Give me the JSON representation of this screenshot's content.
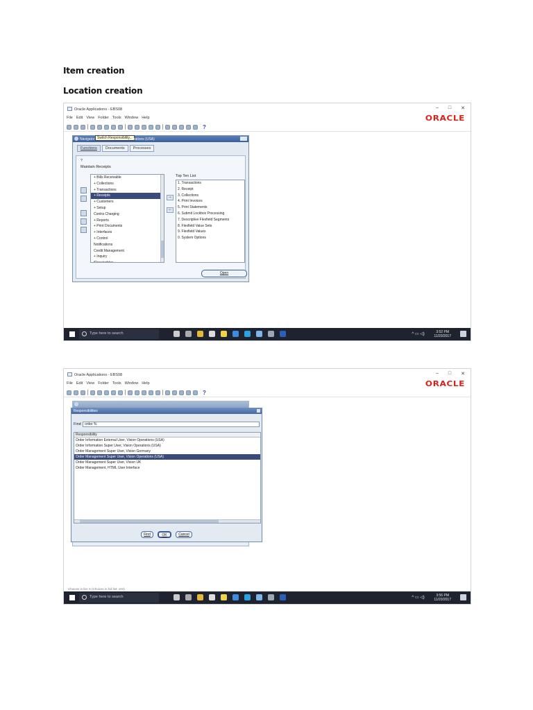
{
  "doc": {
    "heading1": "Item creation",
    "heading2": "Location creation"
  },
  "shared": {
    "app_title": "Oracle Applications - EBS08",
    "menu": [
      "File",
      "Edit",
      "View",
      "Folder",
      "Tools",
      "Window",
      "Help"
    ],
    "logo": "ORACLE",
    "win_minimize": "–",
    "win_maximize": "□",
    "win_close": "✕",
    "help_glyph": "?",
    "taskbar_search": "Type here to search"
  },
  "shot1": {
    "nav_title": "Navigator",
    "tooltip": "Switch Responsibility...",
    "nav_title_rest": "erations (USA)",
    "tabs": [
      "Functions",
      "Documents",
      "Processes"
    ],
    "question": "?",
    "section": "Maintain Receipts",
    "tree_items": [
      {
        "label": "+ Bills Receivable",
        "selected": false
      },
      {
        "label": "+ Collections",
        "selected": false
      },
      {
        "label": "+ Transactions",
        "selected": false
      },
      {
        "label": "+ Receipts",
        "selected": true
      },
      {
        "label": "+ Customers",
        "selected": false
      },
      {
        "label": "+ Setup",
        "selected": false
      },
      {
        "label": "   Contra Charging",
        "selected": false
      },
      {
        "label": "+ Reports",
        "selected": false
      },
      {
        "label": "+ Print Documents",
        "selected": false
      },
      {
        "label": "+ Interfaces",
        "selected": false
      },
      {
        "label": "+ Control",
        "selected": false
      },
      {
        "label": "   Notifications",
        "selected": false
      },
      {
        "label": "   Credit Management",
        "selected": false
      },
      {
        "label": "+ Inquiry",
        "selected": false
      },
      {
        "label": "   iReceivables",
        "selected": false
      }
    ],
    "topten_label": "Top Ten List",
    "topten_items": [
      "1. Transactions",
      "2. Receipt",
      "3. Collections",
      "4. Print Invoices",
      "5. Print Statements",
      "6. Submit Lockbox Processing",
      "7. Descriptive Flexfield Segments",
      "8. Flexfield Value Sets",
      "9. Flexfield Values",
      "0. System Options"
    ],
    "open_button": "Open",
    "clock_time": "3:52 PM",
    "clock_date": "11/20/2017"
  },
  "shot2": {
    "dialog_title": "Responsibilities",
    "find_label": "Find",
    "find_value": "order %",
    "column_header": "Responsibility",
    "items": [
      {
        "label": "Order Information External User, Vision Operations (USA)",
        "selected": false
      },
      {
        "label": "Order Information Super User, Vision Operations (USA)",
        "selected": false
      },
      {
        "label": "Order Management Super User, Vision Germany",
        "selected": false
      },
      {
        "label": "Order Management Super User, Vision Operations (USA)",
        "selected": true
      },
      {
        "label": "Order Management Super User, Vision UK",
        "selected": false
      },
      {
        "label": "Order Management, HTML User Interface",
        "selected": false
      }
    ],
    "find_button": "Find",
    "ok_button": "OK",
    "cancel_button": "Cancel",
    "status_text": "Choices in list: 6 (Choices in full list: 104)",
    "clock_time": "3:56 PM",
    "clock_date": "11/20/2017"
  },
  "colors": {
    "oracle_red": "#d6231c",
    "selection": "#3a4a7a",
    "taskbar": "#1f2330",
    "window_header": "#4667a0"
  }
}
